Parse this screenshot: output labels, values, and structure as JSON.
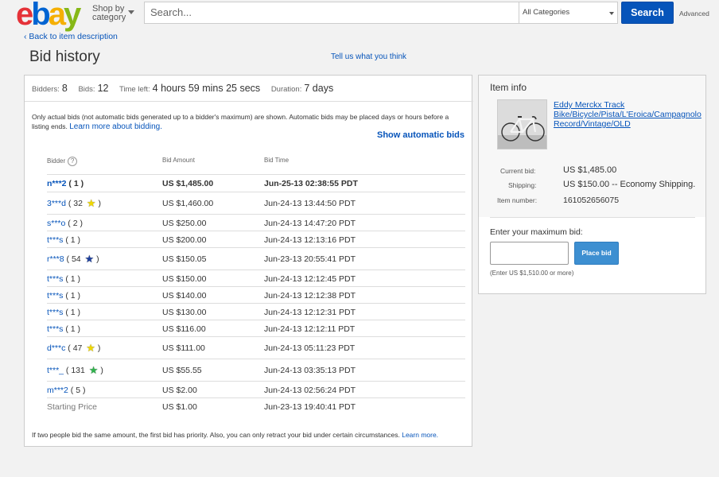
{
  "header": {
    "logo": [
      "e",
      "b",
      "a",
      "y"
    ],
    "shop_by_line1": "Shop by",
    "shop_by_line2": "category",
    "search_placeholder": "Search...",
    "category": "All Categories",
    "search_button": "Search",
    "advanced": "Advanced"
  },
  "nav": {
    "back_link": "‹ Back to item description",
    "page_title": "Bid history",
    "tell_us": "Tell us what you think"
  },
  "stats": {
    "bidders_label": "Bidders:",
    "bidders": "8",
    "bids_label": "Bids:",
    "bids": "12",
    "time_left_label": "Time left:",
    "time_left": "4 hours 59 mins 25 secs",
    "duration_label": "Duration:",
    "duration": "7 days"
  },
  "note": {
    "text": "Only actual bids (not automatic bids generated up to a bidder's maximum) are shown. Automatic bids may be placed days or hours before a listing ends. ",
    "link": "Learn more about bidding."
  },
  "show_automatic": "Show automatic bids",
  "table": {
    "headers": {
      "bidder": "Bidder",
      "amount": "Bid Amount",
      "time": "Bid Time"
    },
    "rows": [
      {
        "bidder": "n***2",
        "score": " ( 1 )",
        "star": "",
        "star_color": "",
        "amount": "US $1,485.00",
        "time": "Jun-25-13 02:38:55 PDT",
        "winner": true,
        "height": 22
      },
      {
        "bidder": "3***d",
        "score": " ( 32 ",
        "star": "★",
        "star_color": "#f0d800",
        "close": " )",
        "amount": "US $1,460.00",
        "time": "Jun-24-13 13:44:50 PDT",
        "height": 28
      },
      {
        "bidder": "s***o",
        "score": " ( 2 )",
        "star": "",
        "amount": "US $250.00",
        "time": "Jun-24-13 14:47:20 PDT",
        "height": 21
      },
      {
        "bidder": "t***s",
        "score": " ( 1 )",
        "star": "",
        "amount": "US $200.00",
        "time": "Jun-24-13 12:13:16 PDT",
        "height": 21
      },
      {
        "bidder": "r***8",
        "score": " ( 54 ",
        "star": "★",
        "star_color": "#1d3f9c",
        "close": " )",
        "amount": "US $150.05",
        "time": "Jun-23-13 20:55:41 PDT",
        "height": 28
      },
      {
        "bidder": "t***s",
        "score": " ( 1 )",
        "star": "",
        "amount": "US $150.00",
        "time": "Jun-24-13 12:12:45 PDT",
        "height": 21
      },
      {
        "bidder": "t***s",
        "score": " ( 1 )",
        "star": "",
        "amount": "US $140.00",
        "time": "Jun-24-13 12:12:38 PDT",
        "height": 21
      },
      {
        "bidder": "t***s",
        "score": " ( 1 )",
        "star": "",
        "amount": "US $130.00",
        "time": "Jun-24-13 12:12:31 PDT",
        "height": 21
      },
      {
        "bidder": "t***s",
        "score": " ( 1 )",
        "star": "",
        "amount": "US $116.00",
        "time": "Jun-24-13 12:12:11 PDT",
        "height": 21
      },
      {
        "bidder": "d***c",
        "score": " ( 47 ",
        "star": "★",
        "star_color": "#f0d800",
        "close": " )",
        "amount": "US $111.00",
        "time": "Jun-24-13 05:11:23 PDT",
        "height": 28
      },
      {
        "bidder": "t***_",
        "score": " ( 131 ",
        "star": "★",
        "star_color": "#2fb24c",
        "close": " )",
        "amount": "US $55.55",
        "time": "Jun-24-13 03:35:13 PDT",
        "height": 28
      },
      {
        "bidder": "m***2",
        "score": " ( 5 )",
        "star": "",
        "amount": "US $2.00",
        "time": "Jun-24-13 02:56:24 PDT",
        "height": 21
      },
      {
        "bidder": "Starting Price",
        "score": "",
        "star": "",
        "amount": "US $1.00",
        "time": "Jun-23-13 19:40:41 PDT",
        "starting": true,
        "height": 21
      }
    ]
  },
  "footer": {
    "text": "If two people bid the same amount, the first bid has priority. Also, you can only retract your bid under certain circumstances. ",
    "link": "Learn more."
  },
  "item_info": {
    "title": "Item info",
    "item_title": "Eddy Merckx Track Bike/Bicycle/Pista/L'Eroica/Campagnolo Record/Vintage/OLD",
    "current_bid_label": "Current bid:",
    "current_bid": "US $1,485.00",
    "shipping_label": "Shipping:",
    "shipping": "US $150.00 -- Economy Shipping.",
    "item_number_label": "Item number:",
    "item_number": "161052656075",
    "max_bid_label": "Enter your maximum bid:",
    "place_bid": "Place bid",
    "enter_note": "(Enter US $1,510.00 or more)"
  }
}
